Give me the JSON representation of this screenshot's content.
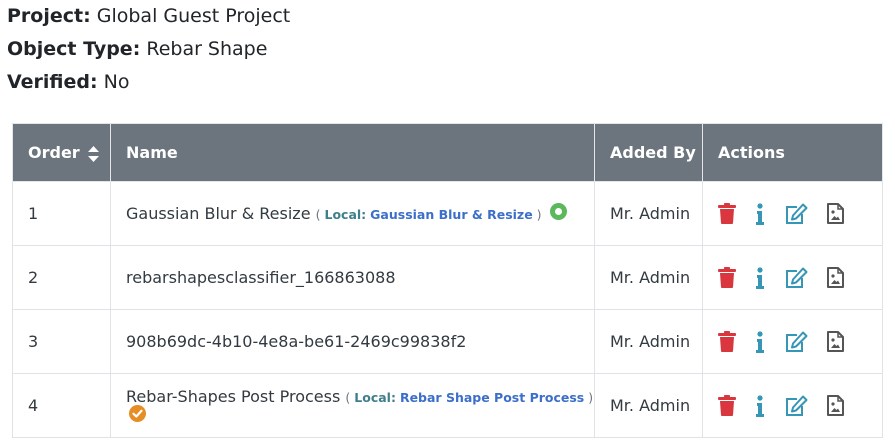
{
  "meta": {
    "project_label": "Project:",
    "project_value": "Global Guest Project",
    "type_label": "Object Type:",
    "type_value": "Rebar Shape",
    "verified_label": "Verified:",
    "verified_value": "No"
  },
  "table": {
    "headers": {
      "order": "Order",
      "name": "Name",
      "added_by": "Added By",
      "actions": "Actions"
    },
    "rows": [
      {
        "order": "1",
        "name": "Gaussian Blur & Resize",
        "local_open": "( ",
        "local_label": "Local:",
        "local_name": "Gaussian Blur & Resize",
        "local_close": " )",
        "status": "active",
        "added_by": "Mr. Admin"
      },
      {
        "order": "2",
        "name": "rebarshapesclassifier_166863088",
        "added_by": "Mr. Admin"
      },
      {
        "order": "3",
        "name": "908b69dc-4b10-4e8a-be61-2469c99838f2",
        "added_by": "Mr. Admin"
      },
      {
        "order": "4",
        "name": "Rebar-Shapes Post Process",
        "local_open": "( ",
        "local_label": "Local:",
        "local_name": "Rebar Shape Post Process",
        "local_close": " )",
        "status": "completed",
        "added_by": "Mr. Admin"
      }
    ]
  },
  "icons": [
    "sort-icon",
    "trash-icon",
    "info-icon",
    "edit-icon",
    "file-image-icon",
    "active-status-icon",
    "completed-status-icon"
  ],
  "colors": {
    "header_bg": "#6c757d",
    "delete": "#d9363e",
    "info": "#3596b5",
    "edit": "#3596b5",
    "file": "#555555",
    "status_active": "#5cb85c",
    "status_completed": "#e58e26",
    "local_link": "#3c6fc9"
  }
}
